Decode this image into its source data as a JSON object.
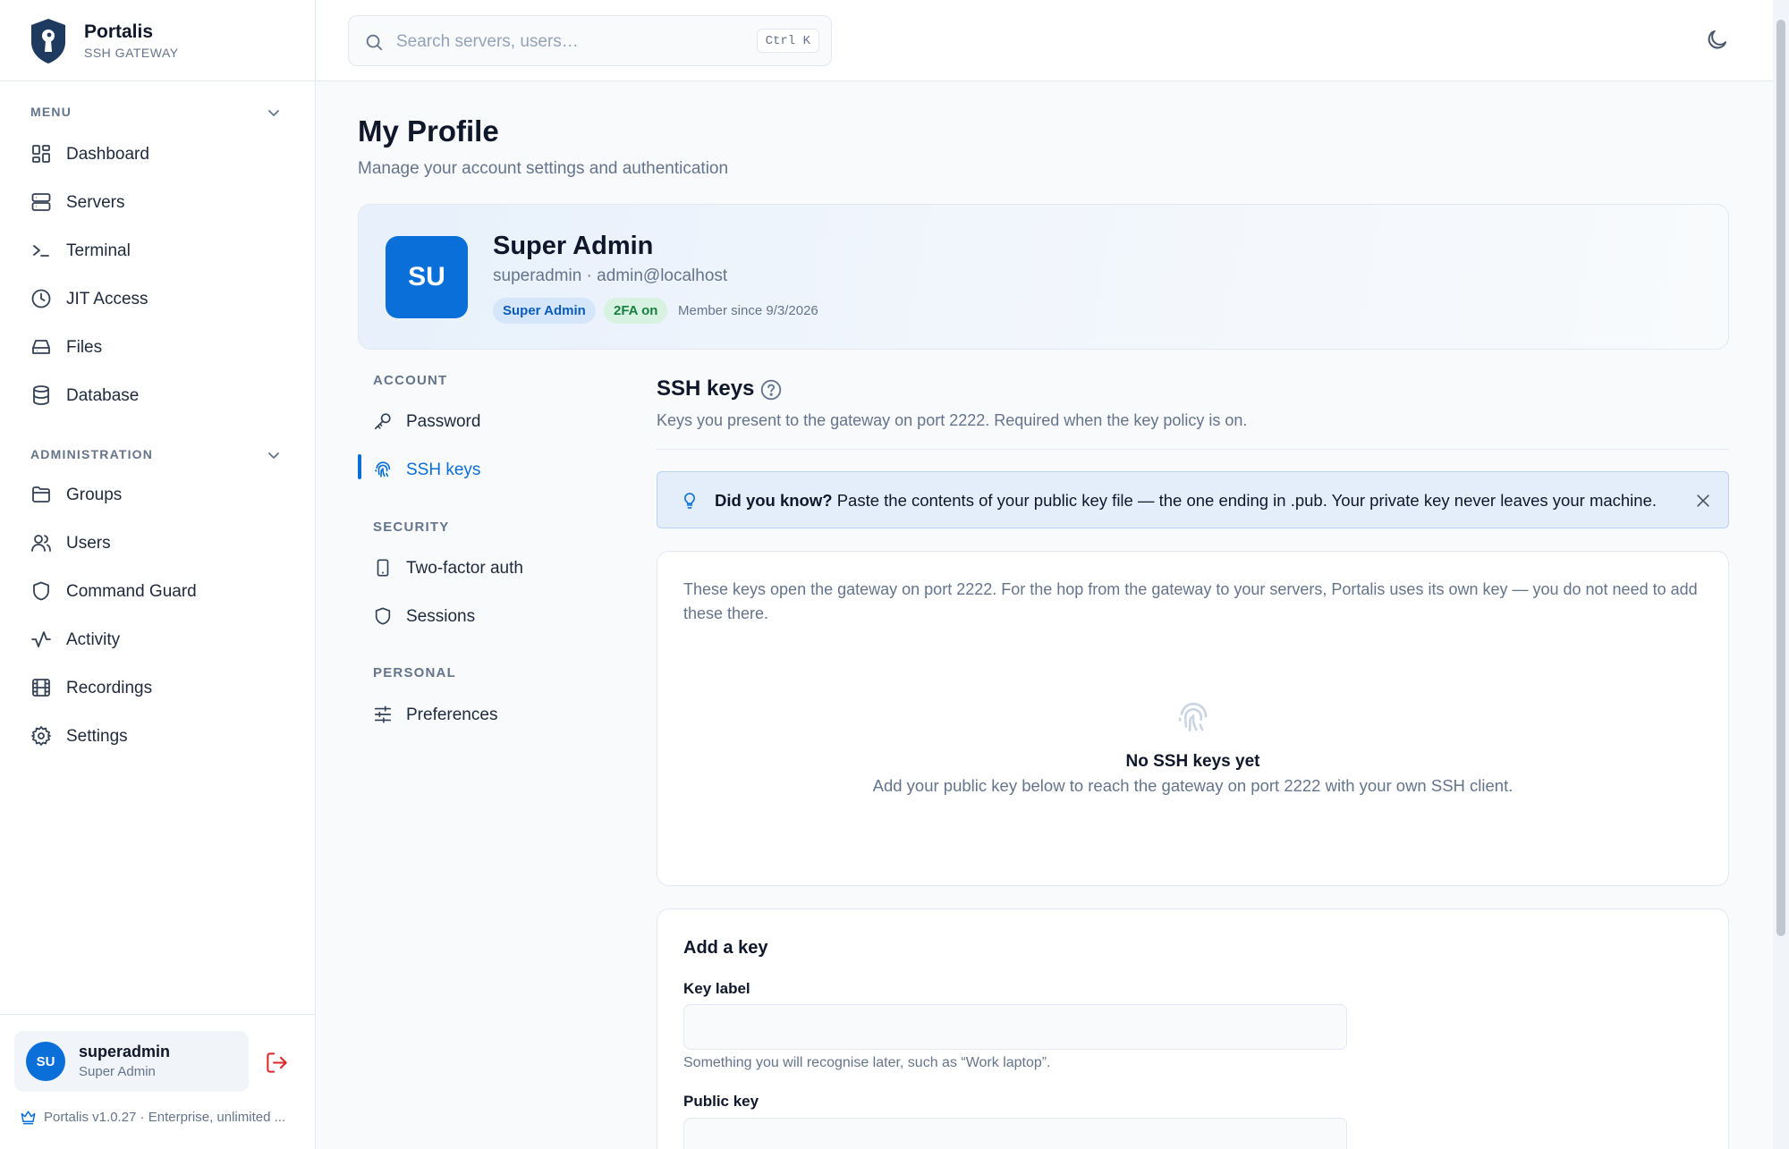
{
  "brand": {
    "name": "Portalis",
    "subtitle": "SSH GATEWAY"
  },
  "sidebar": {
    "menu_heading": "MENU",
    "menu_items": [
      {
        "label": "Dashboard",
        "icon": "dashboard-icon"
      },
      {
        "label": "Servers",
        "icon": "server-icon"
      },
      {
        "label": "Terminal",
        "icon": "terminal-icon"
      },
      {
        "label": "JIT Access",
        "icon": "clock-icon"
      },
      {
        "label": "Files",
        "icon": "drive-icon"
      },
      {
        "label": "Database",
        "icon": "database-icon"
      }
    ],
    "admin_heading": "ADMINISTRATION",
    "admin_items": [
      {
        "label": "Groups",
        "icon": "folder-icon"
      },
      {
        "label": "Users",
        "icon": "users-icon"
      },
      {
        "label": "Command Guard",
        "icon": "shield-icon"
      },
      {
        "label": "Activity",
        "icon": "activity-icon"
      },
      {
        "label": "Recordings",
        "icon": "film-icon"
      },
      {
        "label": "Settings",
        "icon": "gear-icon"
      }
    ],
    "user": {
      "initials": "SU",
      "name": "superadmin",
      "role": "Super Admin"
    },
    "version": "Portalis v1.0.27 · Enterprise, unlimited ..."
  },
  "topbar": {
    "search_placeholder": "Search servers, users…",
    "shortcut": "Ctrl K"
  },
  "page": {
    "title": "My Profile",
    "subtitle": "Manage your account settings and authentication"
  },
  "profile": {
    "initials": "SU",
    "name": "Super Admin",
    "identity": "superadmin · admin@localhost",
    "role_badge": "Super Admin",
    "twofa_badge": "2FA on",
    "member_since": "Member since 9/3/2026"
  },
  "settings_nav": {
    "account_heading": "ACCOUNT",
    "password": "Password",
    "ssh_keys": "SSH keys",
    "security_heading": "SECURITY",
    "two_factor": "Two-factor auth",
    "sessions": "Sessions",
    "personal_heading": "PERSONAL",
    "preferences": "Preferences",
    "active": "SSH keys"
  },
  "ssh_keys": {
    "title": "SSH keys",
    "description": "Keys you present to the gateway on port 2222. Required when the key policy is on.",
    "tip_bold": "Did you know?",
    "tip_text": " Paste the contents of your public key file — the one ending in .pub. Your private key never leaves your machine.",
    "note": "These keys open the gateway on port 2222. For the hop from the gateway to your servers, Portalis uses its own key — you do not need to add these there.",
    "empty_title": "No SSH keys yet",
    "empty_sub": "Add your public key below to reach the gateway on port 2222 with your own SSH client."
  },
  "add_key": {
    "title": "Add a key",
    "label_label": "Key label",
    "label_value": "",
    "label_hint": "Something you will recognise later, such as “Work laptop”.",
    "public_key_label": "Public key",
    "public_key_value": ""
  },
  "colors": {
    "accent": "#0a6fd8",
    "success": "#15803d",
    "danger": "#dc2626"
  }
}
